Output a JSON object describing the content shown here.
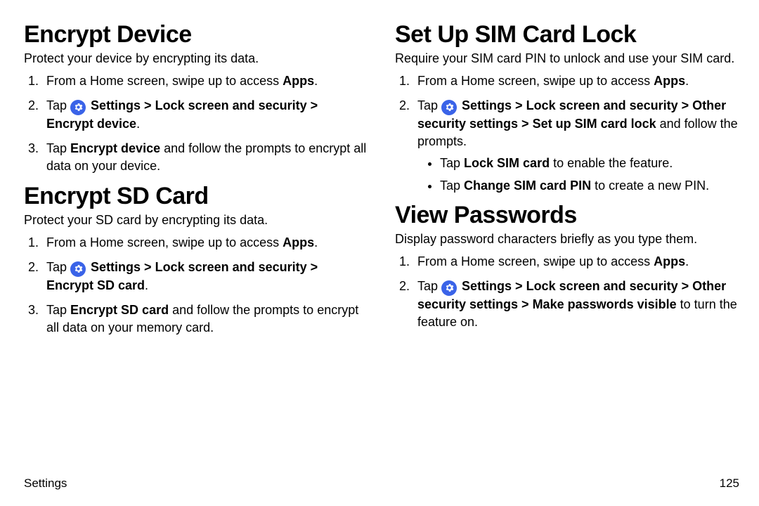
{
  "footer": {
    "section": "Settings",
    "page": "125"
  },
  "left": {
    "sec1": {
      "heading": "Encrypt Device",
      "lead": "Protect your device by encrypting its data.",
      "step1_a": "From a Home screen, swipe up to access ",
      "step1_b": "Apps",
      "step1_c": ".",
      "step2_a": "Tap ",
      "step2_b": "Settings > Lock screen and security > Encrypt device",
      "step2_c": ".",
      "step3_a": "Tap ",
      "step3_b": "Encrypt device",
      "step3_c": " and follow the prompts to encrypt all data on your device."
    },
    "sec2": {
      "heading": "Encrypt SD Card",
      "lead": "Protect your SD card by encrypting its data.",
      "step1_a": "From a Home screen, swipe up to access ",
      "step1_b": "Apps",
      "step1_c": ".",
      "step2_a": "Tap ",
      "step2_b": "Settings > Lock screen and security > Encrypt SD card",
      "step2_c": ".",
      "step3_a": "Tap ",
      "step3_b": "Encrypt SD card",
      "step3_c": " and follow the prompts to encrypt all data on your memory card."
    }
  },
  "right": {
    "sec1": {
      "heading": "Set Up SIM Card Lock",
      "lead": "Require your SIM card PIN to unlock and use your SIM card.",
      "step1_a": "From a Home screen, swipe up to access ",
      "step1_b": "Apps",
      "step1_c": ".",
      "step2_a": "Tap ",
      "step2_b": "Settings > Lock screen and security > Other security settings > Set up SIM card lock",
      "step2_c": " and follow the prompts.",
      "bullet1_a": "Tap ",
      "bullet1_b": "Lock SIM card",
      "bullet1_c": " to enable the feature.",
      "bullet2_a": "Tap ",
      "bullet2_b": "Change SIM card PIN",
      "bullet2_c": " to create a new PIN."
    },
    "sec2": {
      "heading": "View Passwords",
      "lead": "Display password characters briefly as you type them.",
      "step1_a": "From a Home screen, swipe up to access ",
      "step1_b": "Apps",
      "step1_c": ".",
      "step2_a": "Tap ",
      "step2_b": "Settings > Lock screen and security > Other security settings > Make passwords visible",
      "step2_c": " to turn the feature on."
    }
  }
}
